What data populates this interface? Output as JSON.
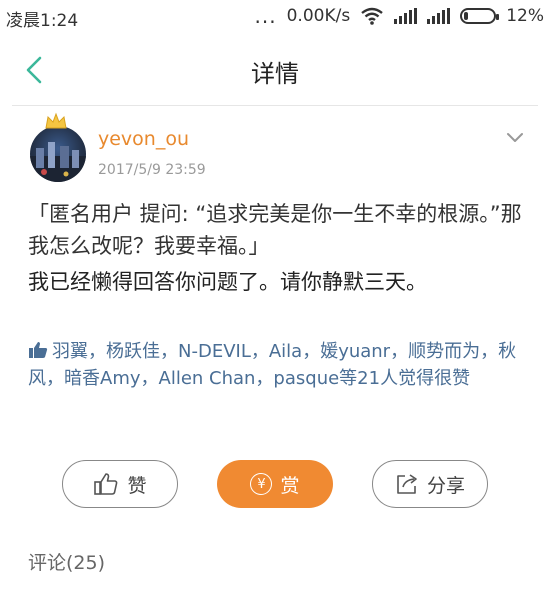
{
  "status_bar": {
    "time": "凌晨1:24",
    "dots": "...",
    "net_speed": "0.00K/s",
    "battery": "12%",
    "battery_level": 0.12
  },
  "nav": {
    "title": "详情"
  },
  "post": {
    "username": "yevon_ou",
    "timestamp": "2017/5/9 23:59",
    "quote": "「匿名用户  提问: “追求完美是你一生不幸的根源。”那我怎么改呢？我要幸福。」",
    "answer": "我已经懒得回答你问题了。请你静默三天。"
  },
  "likes": {
    "text": "羽翼，杨跃佳，N-DEVIL，Aila，媛yuanr，顺势而为，秋风，暗香Amy，Allen Chan，pasque等21人觉得很赞"
  },
  "actions": {
    "like_label": "赞",
    "reward_label": "赏",
    "reward_symbol": "¥",
    "share_label": "分享"
  },
  "comments": {
    "label": "评论(25)"
  },
  "colors": {
    "accent_green": "#3bb89a",
    "username_orange": "#e8892e",
    "reward_orange": "#f08a32",
    "link_blue": "#4a6e95"
  },
  "icons": [
    "wifi-icon",
    "signal-icon",
    "battery-icon",
    "back-arrow-icon",
    "crown-icon",
    "chevron-down-icon",
    "thumbs-up-icon",
    "yen-icon",
    "share-icon"
  ]
}
